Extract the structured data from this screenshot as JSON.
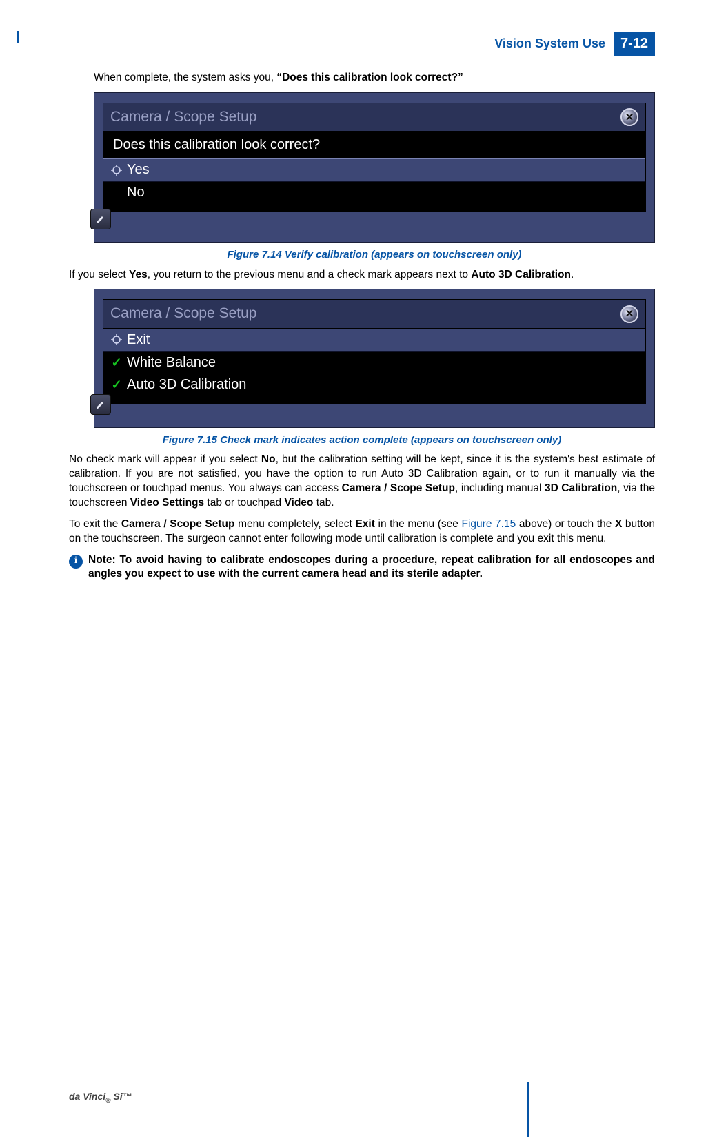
{
  "header": {
    "section_title": "Vision System Use",
    "page_number": "7-12"
  },
  "intro": {
    "lead_plain": "When complete, the system asks you, ",
    "lead_bold": "“Does this calibration look correct?”"
  },
  "figure1": {
    "title": "Camera / Scope Setup",
    "close_label": "✕",
    "prompt": "Does this calibration look correct?",
    "option_yes": "Yes",
    "option_no": "No",
    "caption": "Figure 7.14 Verify calibration (appears on touchscreen only)"
  },
  "para_yes": {
    "p1a": "If you select ",
    "p1b": "Yes",
    "p1c": ", you return to the previous menu and a check mark appears next to ",
    "p1d": "Auto 3D Calibration",
    "p1e": "."
  },
  "figure2": {
    "title": "Camera / Scope Setup",
    "close_label": "✕",
    "option_exit": "Exit",
    "option_wb": "White Balance",
    "option_a3d": "Auto 3D Calibration",
    "caption": "Figure 7.15 Check mark indicates action complete (appears on touchscreen only)"
  },
  "para_no": {
    "a": "No check mark will appear if you select ",
    "b": "No",
    "c": ", but the calibration setting will be kept, since it is the system's best estimate of calibration. If you are not satisfied, you have the option to run Auto 3D Calibration again, or to run it manually via the touchscreen or touchpad menus. You always can access ",
    "d": "Camera / Scope Setup",
    "e": ", including manual ",
    "f": "3D Calibration",
    "g": ", via the touchscreen ",
    "h": "Video Settings",
    "i": " tab or touchpad ",
    "j": "Video",
    "k": " tab."
  },
  "para_exit": {
    "a": "To exit the ",
    "b": "Camera / Scope Setup",
    "c": " menu completely, select ",
    "d": "Exit",
    "e": " in the menu (see ",
    "link": "Figure 7.15",
    "f": " above) or touch the ",
    "g": "X",
    "h": " button on the touchscreen. The surgeon cannot enter following mode until calibration is complete and you exit this menu."
  },
  "note": {
    "icon": "i",
    "text": "Note: To avoid having to calibrate endoscopes during a procedure, repeat calibration for all endoscopes and angles you expect to use with the current camera head and its sterile adapter."
  },
  "footer": {
    "product": "da Vinci",
    "reg": "®",
    "suffix": " Si™"
  }
}
